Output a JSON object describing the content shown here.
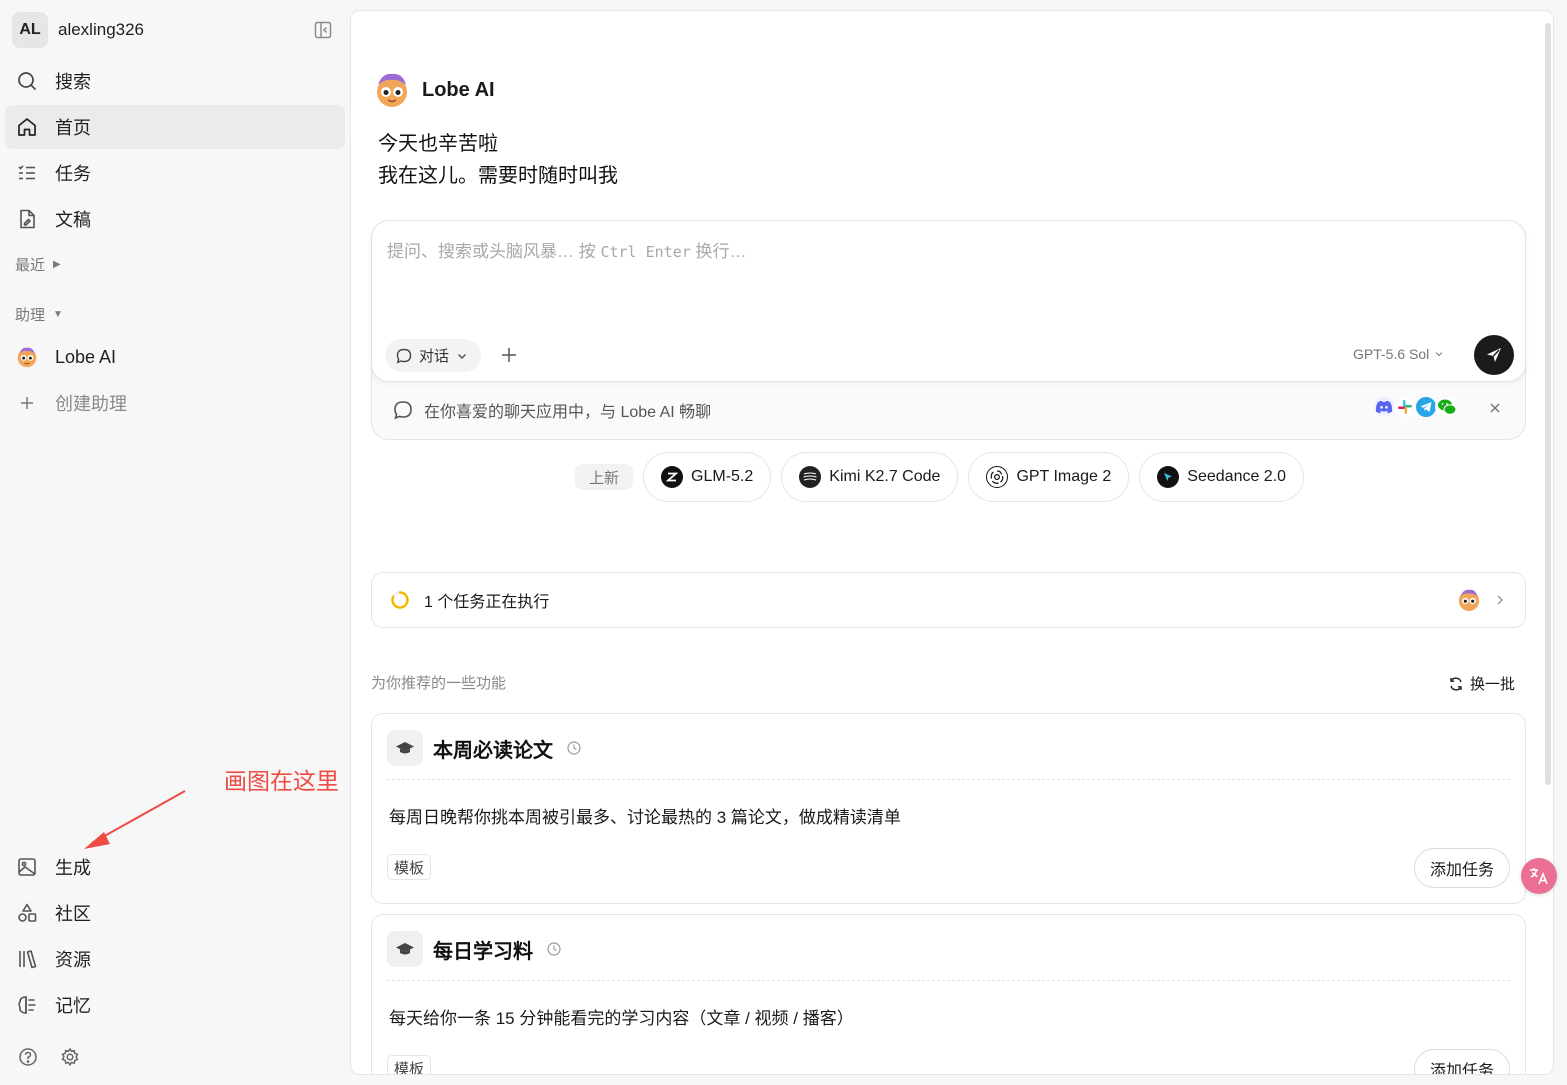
{
  "user": {
    "avatar_initials": "AL",
    "name": "alexling326"
  },
  "sidebar": {
    "top_items": [
      {
        "label": "搜索",
        "icon": "search-icon"
      },
      {
        "label": "首页",
        "icon": "home-icon",
        "active": true
      },
      {
        "label": "任务",
        "icon": "task-list-icon"
      },
      {
        "label": "文稿",
        "icon": "document-icon"
      }
    ],
    "recent_label": "最近",
    "assistants_label": "助理",
    "assistants": [
      {
        "label": "Lobe AI",
        "icon": "lobe-ai-avatar"
      }
    ],
    "create_assistant_label": "创建助理",
    "bottom_items": [
      {
        "label": "生成",
        "icon": "image-icon"
      },
      {
        "label": "社区",
        "icon": "shapes-icon"
      },
      {
        "label": "资源",
        "icon": "library-icon"
      },
      {
        "label": "记忆",
        "icon": "brain-icon"
      }
    ],
    "annotation": "画图在这里"
  },
  "main": {
    "agent_name": "Lobe AI",
    "greeting_line1": "今天也辛苦啦",
    "greeting_line2": "我在这儿。需要时随时叫我",
    "input": {
      "placeholder_prefix": "提问、搜索或头脑风暴… 按 ",
      "placeholder_shortcut": "Ctrl Enter",
      "placeholder_suffix": " 换行…"
    },
    "mode_label": "对话",
    "model_label": "GPT-5.6 Sol",
    "promo_text": "在你喜爱的聊天应用中，与 Lobe AI 畅聊",
    "promo_apps": [
      "discord-icon",
      "slack-icon",
      "telegram-icon",
      "wechat-icon"
    ],
    "new_label": "上新",
    "new_models": [
      {
        "label": "GLM-5.2",
        "icon": "zhipu-logo"
      },
      {
        "label": "Kimi K2.7 Code",
        "icon": "kimi-logo"
      },
      {
        "label": "GPT Image 2",
        "icon": "openai-logo"
      },
      {
        "label": "Seedance 2.0",
        "icon": "seedance-logo"
      }
    ],
    "task_status": "1 个任务正在执行",
    "recommend_header": "为你推荐的一些功能",
    "refresh_label": "换一批",
    "recommendations": [
      {
        "title": "本周必读论文",
        "desc": "每周日晚帮你挑本周被引最多、讨论最热的 3 篇论文，做成精读清单",
        "tag": "模板",
        "action": "添加任务"
      },
      {
        "title": "每日学习料",
        "desc": "每天给你一条 15 分钟能看完的学习内容（文章 / 视频 / 播客）",
        "tag": "模板",
        "action": "添加任务"
      }
    ]
  },
  "colors": {
    "accent_annotation": "#ee4b45",
    "send_button": "#1b1b1b",
    "spinner": "#f5b800",
    "translate_fab": "#ea6f93"
  }
}
